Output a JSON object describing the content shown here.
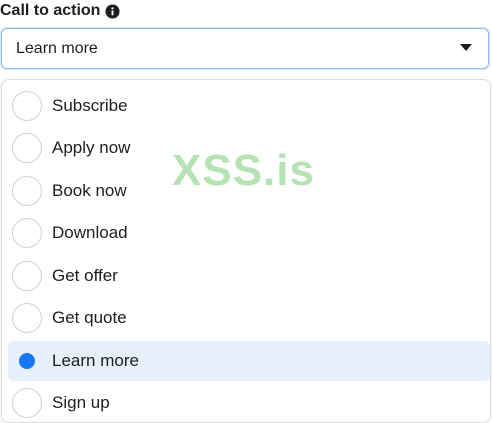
{
  "field": {
    "label": "Call to action",
    "info_icon": "info-circle-icon"
  },
  "select": {
    "value": "Learn more",
    "caret_icon": "caret-down-icon"
  },
  "options": [
    {
      "label": "Subscribe",
      "selected": false
    },
    {
      "label": "Apply now",
      "selected": false
    },
    {
      "label": "Book now",
      "selected": false
    },
    {
      "label": "Download",
      "selected": false
    },
    {
      "label": "Get offer",
      "selected": false
    },
    {
      "label": "Get quote",
      "selected": false
    },
    {
      "label": "Learn more",
      "selected": true
    },
    {
      "label": "Sign up",
      "selected": false
    }
  ],
  "watermark": "XSS.is",
  "colors": {
    "accent": "#1877f2",
    "selected_bg": "#e7effa",
    "watermark": "#5cc25a"
  }
}
